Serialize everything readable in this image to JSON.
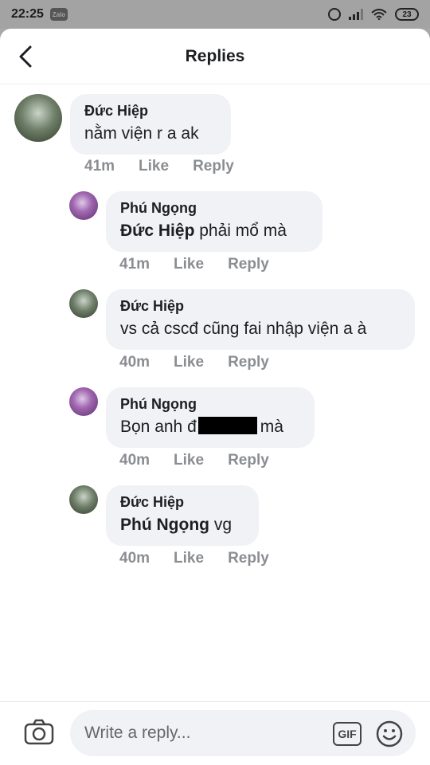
{
  "status_bar": {
    "time": "22:25",
    "app_badge": "Zalo",
    "battery": "23"
  },
  "header": {
    "title": "Replies"
  },
  "comments": [
    {
      "author": "Đức Hiệp",
      "mention": "",
      "text": "nằm viện r a ak",
      "time": "41m",
      "like": "Like",
      "reply": "Reply",
      "avatar": "duc-hiep"
    },
    {
      "author": "Phú Ngọng",
      "mention": "Đức Hiệp",
      "text": " phải mổ mà",
      "time": "41m",
      "like": "Like",
      "reply": "Reply",
      "avatar": "phu-ngong"
    },
    {
      "author": "Đức Hiệp",
      "mention": "",
      "text": "vs cả cscđ cũng fai nhập viện a à",
      "time": "40m",
      "like": "Like",
      "reply": "Reply",
      "avatar": "duc-hiep"
    },
    {
      "author": "Phú Ngọng",
      "mention": "",
      "text_before": "Bọn anh đ",
      "text_after": "mà",
      "redacted": true,
      "time": "40m",
      "like": "Like",
      "reply": "Reply",
      "avatar": "phu-ngong"
    },
    {
      "author": "Đức Hiệp",
      "mention": "Phú Ngọng",
      "text": " vg",
      "time": "40m",
      "like": "Like",
      "reply": "Reply",
      "avatar": "duc-hiep"
    }
  ],
  "composer": {
    "placeholder": "Write a reply...",
    "gif_label": "GIF",
    "icons": [
      "camera-icon",
      "gif-icon",
      "emoji-icon"
    ]
  },
  "colors": {
    "bubble": "#f0f2f5",
    "meta_text": "#8a8d91",
    "text": "#1c1e21"
  }
}
